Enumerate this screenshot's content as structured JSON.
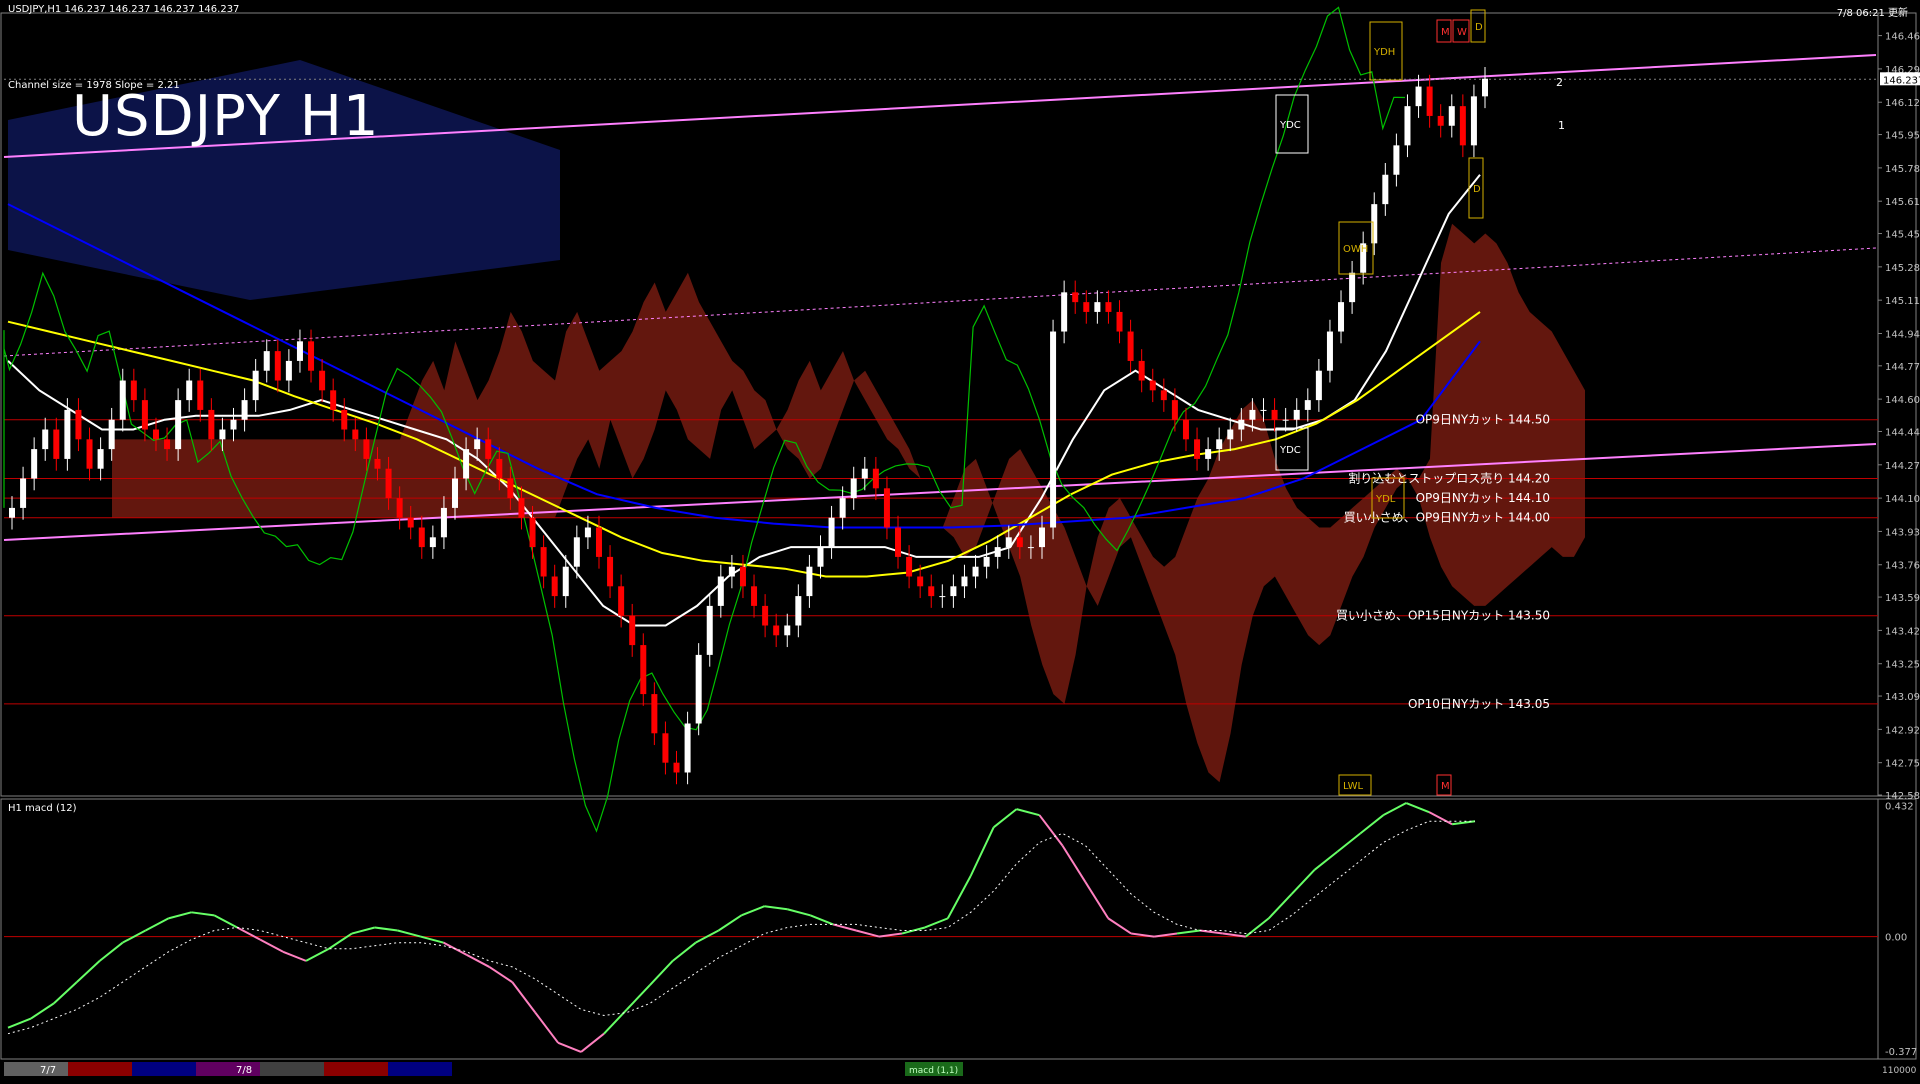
{
  "header": {
    "symbol_info": "USDJPY,H1  146.237 146.237 146.237 146.237",
    "channel_info": "Channel size = 1978 Slope = 2.21",
    "big_title": "USDJPY H1",
    "datetime": "7/8 06:21 更新"
  },
  "colors": {
    "background": "#000000",
    "bull_candle": "#ffffff",
    "bear_candle": "#ff0000",
    "ma_white": "#ffffff",
    "ma_yellow": "#ffff00",
    "ma_blue": "#0000ff",
    "chikou": "#00c000",
    "kumo_bull": "#1a2aa0",
    "kumo_bear": "#b42a1a",
    "trendline": "#ff80ff",
    "level_line": "#c00000",
    "macd_up": "#66ff66",
    "macd_down": "#ff80c0"
  },
  "marker_labels": {
    "ydh": "YDH",
    "ydc_top": "YDC",
    "ydc_bottom": "YDC",
    "ydl": "YDL",
    "lwl": "LWL",
    "m": "M",
    "mw_m": "M",
    "mw_w": "W",
    "mw_d": "D",
    "d_mid": "D",
    "owh": "OWH",
    "side_2": "2",
    "side_1": "1"
  },
  "annotations": [
    {
      "text": "OP9日NYカット 144.50",
      "price": 144.5
    },
    {
      "text": "割り込むとストップロス売り 144.20",
      "price": 144.2
    },
    {
      "text": "OP9日NYカット 144.10",
      "price": 144.1
    },
    {
      "text": "買い小さめ、OP9日NYカット 144.00",
      "price": 144.0
    },
    {
      "text": "買い小さめ、OP15日NYカット 143.50",
      "price": 143.5
    },
    {
      "text": "OP10日NYカット 143.05",
      "price": 143.05
    }
  ],
  "bottom_bar": {
    "dates": [
      "7/7",
      "7/8"
    ],
    "indicator_tag": "macd (1,1)",
    "macd_scale_top": "110000"
  },
  "chart_data": [
    {
      "type": "candlestick",
      "title": "USDJPY,H1",
      "current_price": "146.237",
      "price_axis_ticks": [
        "146.460",
        "146.290",
        "146.120",
        "145.955",
        "145.785",
        "145.615",
        "145.450",
        "145.280",
        "145.110",
        "144.940",
        "144.775",
        "144.605",
        "144.440",
        "144.270",
        "144.100",
        "143.930",
        "143.760",
        "143.595",
        "143.425",
        "143.255",
        "143.090",
        "142.920",
        "142.750",
        "142.585"
      ],
      "ylim": [
        142.58,
        146.56
      ],
      "candles_close": [
        144.05,
        144.2,
        144.35,
        144.45,
        144.3,
        144.55,
        144.4,
        144.25,
        144.35,
        144.5,
        144.7,
        144.6,
        144.45,
        144.4,
        144.35,
        144.6,
        144.7,
        144.55,
        144.4,
        144.45,
        144.5,
        144.6,
        144.75,
        144.85,
        144.7,
        144.8,
        144.9,
        144.75,
        144.65,
        144.55,
        144.45,
        144.4,
        144.3,
        144.25,
        144.1,
        144.0,
        143.95,
        143.85,
        143.9,
        144.05,
        144.2,
        144.35,
        144.4,
        144.3,
        144.2,
        144.1,
        144.0,
        143.85,
        143.7,
        143.6,
        143.75,
        143.9,
        143.95,
        143.8,
        143.65,
        143.5,
        143.35,
        143.1,
        142.9,
        142.75,
        142.7,
        142.95,
        143.3,
        143.55,
        143.7,
        143.75,
        143.65,
        143.55,
        143.45,
        143.4,
        143.45,
        143.6,
        143.75,
        143.85,
        144.0,
        144.1,
        144.2,
        144.25,
        144.15,
        143.95,
        143.8,
        143.7,
        143.65,
        143.6,
        143.6,
        143.65,
        143.7,
        143.75,
        143.8,
        143.85,
        143.9,
        143.85,
        143.85,
        143.95,
        144.95,
        145.15,
        145.1,
        145.05,
        145.1,
        145.05,
        144.95,
        144.8,
        144.7,
        144.65,
        144.6,
        144.5,
        144.4,
        144.3,
        144.35,
        144.4,
        144.45,
        144.5,
        144.55,
        144.55,
        144.5,
        144.5,
        144.55,
        144.6,
        144.75,
        144.95,
        145.1,
        145.25,
        145.4,
        145.6,
        145.75,
        145.9,
        146.1,
        146.2,
        146.05,
        146.0,
        146.1,
        145.9,
        146.15,
        146.24
      ],
      "series": [
        {
          "name": "MA white",
          "values": [
            144.8,
            144.65,
            144.55,
            144.45,
            144.45,
            144.5,
            144.52,
            144.52,
            144.52,
            144.55,
            144.6,
            144.55,
            144.5,
            144.45,
            144.4,
            144.3,
            144.15,
            143.95,
            143.75,
            143.55,
            143.45,
            143.45,
            143.55,
            143.7,
            143.8,
            143.85,
            143.85,
            143.85,
            143.85,
            143.8,
            143.8,
            143.8,
            143.85,
            144.1,
            144.4,
            144.65,
            144.75,
            144.65,
            144.55,
            144.5,
            144.45,
            144.45,
            144.5,
            144.6,
            144.85,
            145.2,
            145.55,
            145.75
          ]
        },
        {
          "name": "MA yellow",
          "values": [
            145.0,
            144.95,
            144.9,
            144.85,
            144.8,
            144.75,
            144.7,
            144.62,
            144.55,
            144.48,
            144.4,
            144.3,
            144.2,
            144.1,
            144.0,
            143.9,
            143.82,
            143.78,
            143.76,
            143.74,
            143.7,
            143.7,
            143.72,
            143.78,
            143.88,
            144.0,
            144.12,
            144.22,
            144.28,
            144.32,
            144.35,
            144.4,
            144.48,
            144.6,
            144.75,
            144.9,
            145.05
          ]
        },
        {
          "name": "MA blue",
          "values": [
            145.6,
            145.45,
            145.3,
            145.15,
            145.0,
            144.85,
            144.7,
            144.55,
            144.4,
            144.25,
            144.12,
            144.05,
            144.0,
            143.97,
            143.95,
            143.95,
            143.95,
            143.96,
            143.98,
            144.0,
            144.05,
            144.1,
            144.2,
            144.35,
            144.5,
            144.9
          ]
        }
      ]
    },
    {
      "type": "line",
      "title": "H1  macd (12)",
      "axis_ticks": [
        "0.432",
        "0.00",
        "-0.377"
      ],
      "ylim": [
        -0.4,
        0.45
      ],
      "series": [
        {
          "name": "MACD",
          "values": [
            -0.3,
            -0.27,
            -0.22,
            -0.15,
            -0.08,
            -0.02,
            0.02,
            0.06,
            0.08,
            0.07,
            0.03,
            -0.01,
            -0.05,
            -0.08,
            -0.04,
            0.01,
            0.03,
            0.02,
            0.0,
            -0.02,
            -0.06,
            -0.1,
            -0.15,
            -0.25,
            -0.35,
            -0.38,
            -0.32,
            -0.24,
            -0.16,
            -0.08,
            -0.02,
            0.02,
            0.07,
            0.1,
            0.09,
            0.07,
            0.04,
            0.02,
            0.0,
            0.01,
            0.03,
            0.06,
            0.2,
            0.36,
            0.42,
            0.4,
            0.3,
            0.18,
            0.06,
            0.01,
            0.0,
            0.01,
            0.02,
            0.01,
            0.0,
            0.06,
            0.14,
            0.22,
            0.28,
            0.34,
            0.4,
            0.44,
            0.41,
            0.37,
            0.38
          ]
        },
        {
          "name": "Signal",
          "values": [
            -0.32,
            -0.3,
            -0.27,
            -0.24,
            -0.2,
            -0.15,
            -0.1,
            -0.05,
            -0.01,
            0.02,
            0.03,
            0.02,
            0.0,
            -0.02,
            -0.04,
            -0.04,
            -0.03,
            -0.02,
            -0.02,
            -0.03,
            -0.05,
            -0.08,
            -0.1,
            -0.14,
            -0.19,
            -0.24,
            -0.26,
            -0.25,
            -0.22,
            -0.17,
            -0.12,
            -0.07,
            -0.03,
            0.01,
            0.03,
            0.04,
            0.04,
            0.04,
            0.03,
            0.02,
            0.02,
            0.03,
            0.08,
            0.15,
            0.24,
            0.31,
            0.34,
            0.3,
            0.22,
            0.14,
            0.08,
            0.04,
            0.02,
            0.02,
            0.01,
            0.02,
            0.07,
            0.13,
            0.19,
            0.25,
            0.31,
            0.35,
            0.38,
            0.38,
            0.38
          ]
        }
      ]
    }
  ]
}
